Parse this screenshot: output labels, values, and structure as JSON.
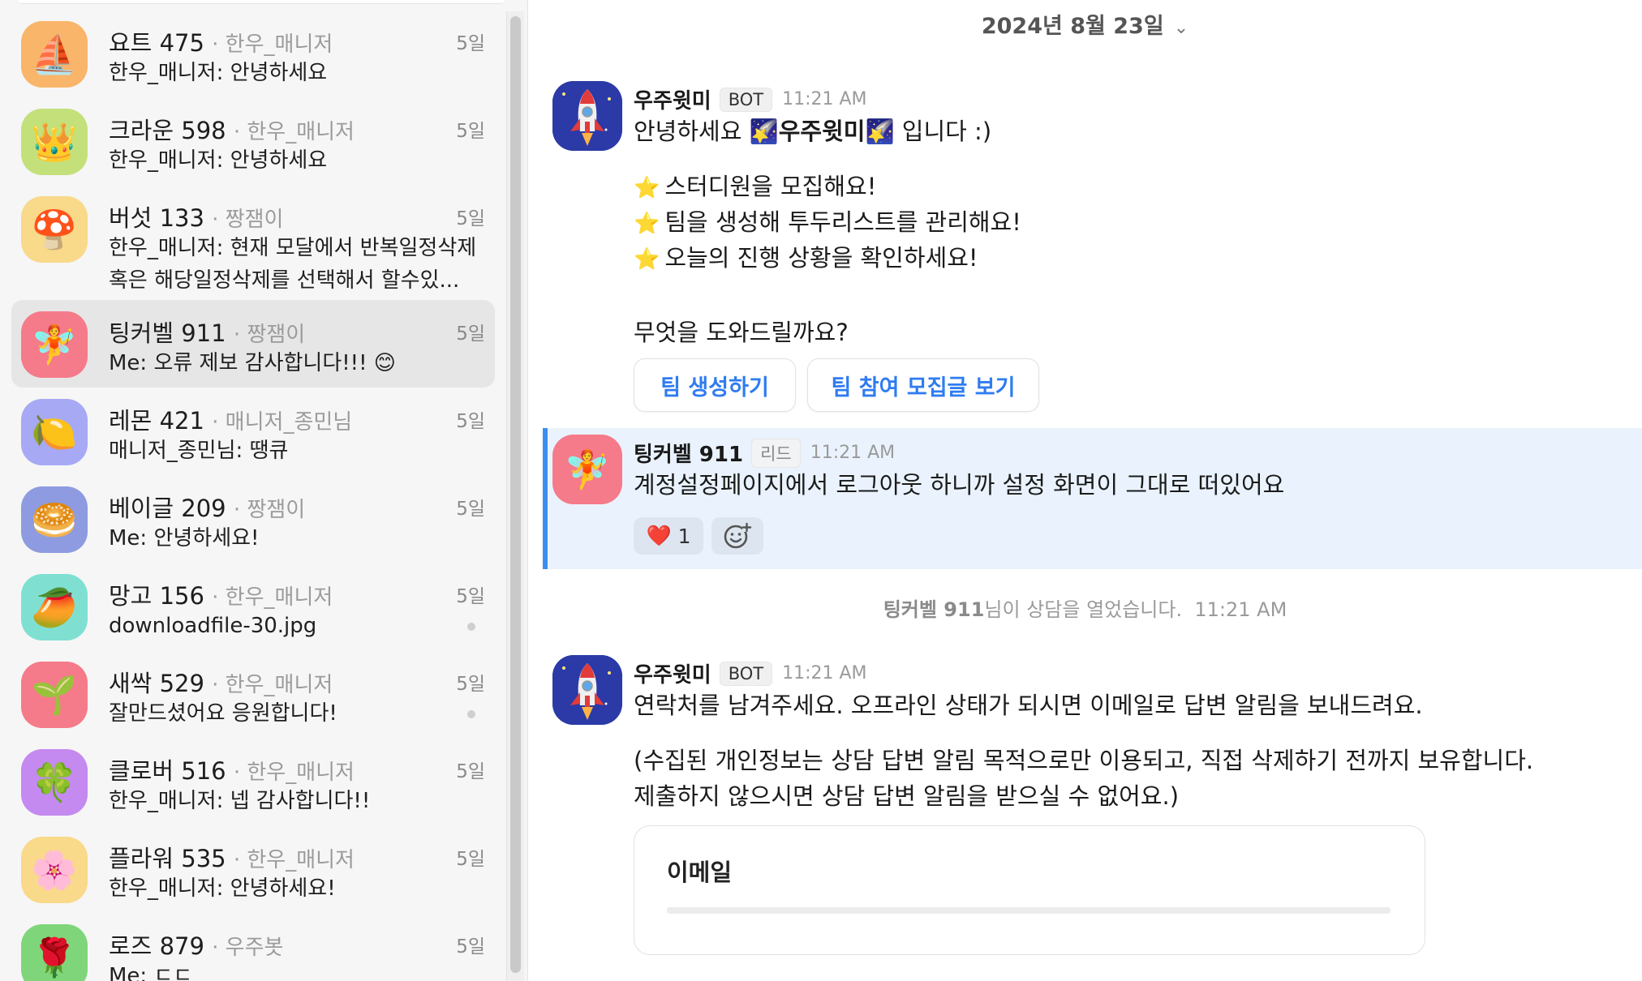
{
  "sidebar": {
    "items": [
      {
        "name": "요트 475",
        "sub": "· 한우_매니저",
        "date": "5일",
        "preview": "한우_매니저: 안녕하세요",
        "emoji": "⛵",
        "bg": "#f9b56a"
      },
      {
        "name": "크라운 598",
        "sub": "· 한우_매니저",
        "date": "5일",
        "preview": "한우_매니저: 안녕하세요",
        "emoji": "👑",
        "bg": "#c4e07a"
      },
      {
        "name": "버섯 133",
        "sub": "· 짱잼이",
        "date": "5일",
        "preview": "한우_매니저: 현재 모달에서 반복일정삭제 혹은 해당일정삭제를 선택해서 할수있...",
        "emoji": "🍄",
        "bg": "#f9d98a"
      },
      {
        "name": "팅커벨 911",
        "sub": "· 짱잼이",
        "date": "5일",
        "preview": "Me: 오류 제보 감사합니다!!! 😊",
        "emoji": "🧚",
        "bg": "#f57b8a"
      },
      {
        "name": "레몬 421",
        "sub": "· 매니저_종민님",
        "date": "5일",
        "preview": "매니저_종민님: 땡큐",
        "emoji": "🍋",
        "bg": "#a7a9f5"
      },
      {
        "name": "베이글 209",
        "sub": "· 짱잼이",
        "date": "5일",
        "preview": "Me: 안녕하세요!",
        "emoji": "🥯",
        "bg": "#8e9be0"
      },
      {
        "name": "망고 156",
        "sub": "· 한우_매니저",
        "date": "5일",
        "preview": "downloadfile-30.jpg",
        "emoji": "🥭",
        "bg": "#7fe0d2"
      },
      {
        "name": "새싹 529",
        "sub": "· 한우_매니저",
        "date": "5일",
        "preview": "잘만드셨어요 응원합니다!",
        "emoji": "🌱",
        "bg": "#f57b8a"
      },
      {
        "name": "클로버 516",
        "sub": "· 한우_매니저",
        "date": "5일",
        "preview": "한우_매니저: 넵 감사합니다!!",
        "emoji": "🍀",
        "bg": "#c48af0"
      },
      {
        "name": "플라워 535",
        "sub": "· 한우_매니저",
        "date": "5일",
        "preview": "한우_매니저: 안녕하세요!",
        "emoji": "🌸",
        "bg": "#f9d98a"
      },
      {
        "name": "로즈 879",
        "sub": "· 우주봇",
        "date": "5일",
        "preview": "Me: ㄷㄷ",
        "emoji": "🌹",
        "bg": "#7fd67a"
      }
    ]
  },
  "chat": {
    "date": "2024년 8월 23일",
    "msg1": {
      "sender": "우주윗미",
      "badge": "BOT",
      "time": "11:21 AM",
      "greet_pre": "안녕하세요 ",
      "greet_icon": "🌠",
      "greet_name": "우주윗미",
      "greet_post": " 입니다 :)",
      "star": "⭐",
      "lines": [
        "스터디원을 모집해요!",
        "팀을 생성해 투두리스트를 관리해요!",
        "오늘의 진행 상황을 확인하세요!"
      ],
      "question": "무엇을 도와드릴까요?",
      "buttons": [
        "팀 생성하기",
        "팀 참여 모집글 보기"
      ]
    },
    "msg2": {
      "sender": "팅커벨 911",
      "badge": "리드",
      "time": "11:21 AM",
      "text": "계정설정페이지에서 로그아웃 하니까 설정 화면이 그대로 떠있어요",
      "reaction_emoji": "❤️",
      "reaction_count": "1",
      "emoji": "🧚"
    },
    "system": {
      "name": "팅커벨 911",
      "text": "님이 상담을 열었습니다.",
      "time": "11:21 AM"
    },
    "msg3": {
      "sender": "우주윗미",
      "badge": "BOT",
      "time": "11:21 AM",
      "text": "연락처를 남겨주세요. 오프라인 상태가 되시면 이메일로 답변 알림을 보내드려요.",
      "note1": "(수집된 개인정보는 상담 답변 알림 목적으로만 이용되고, 직접 삭제하기 전까지 보유합니다.",
      "note2": "제출하지 않으시면 상담 답변 알림을 받으실 수 없어요.)",
      "email_label": "이메일",
      "email_value": ""
    }
  }
}
